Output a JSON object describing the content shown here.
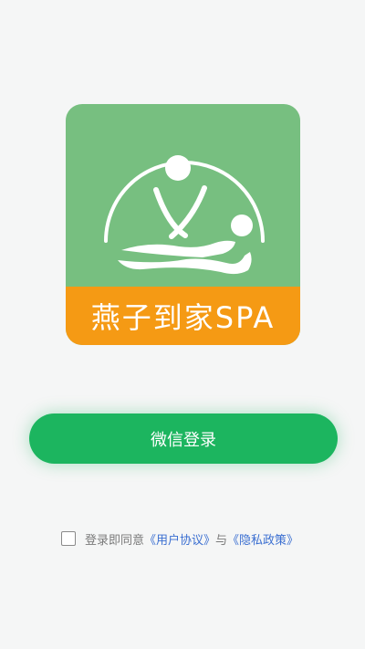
{
  "logo": {
    "text": "燕子到家SPA",
    "colors": {
      "top": "#77bf80",
      "band": "#f59a14"
    }
  },
  "login_button": {
    "label": "微信登录",
    "color": "#1cb55f"
  },
  "agreement": {
    "checked": false,
    "prefix": "登录即同意",
    "user_agreement": "《用户协议》",
    "connector": "与",
    "privacy_policy": "《隐私政策》",
    "link_color": "#3b6fd1"
  }
}
